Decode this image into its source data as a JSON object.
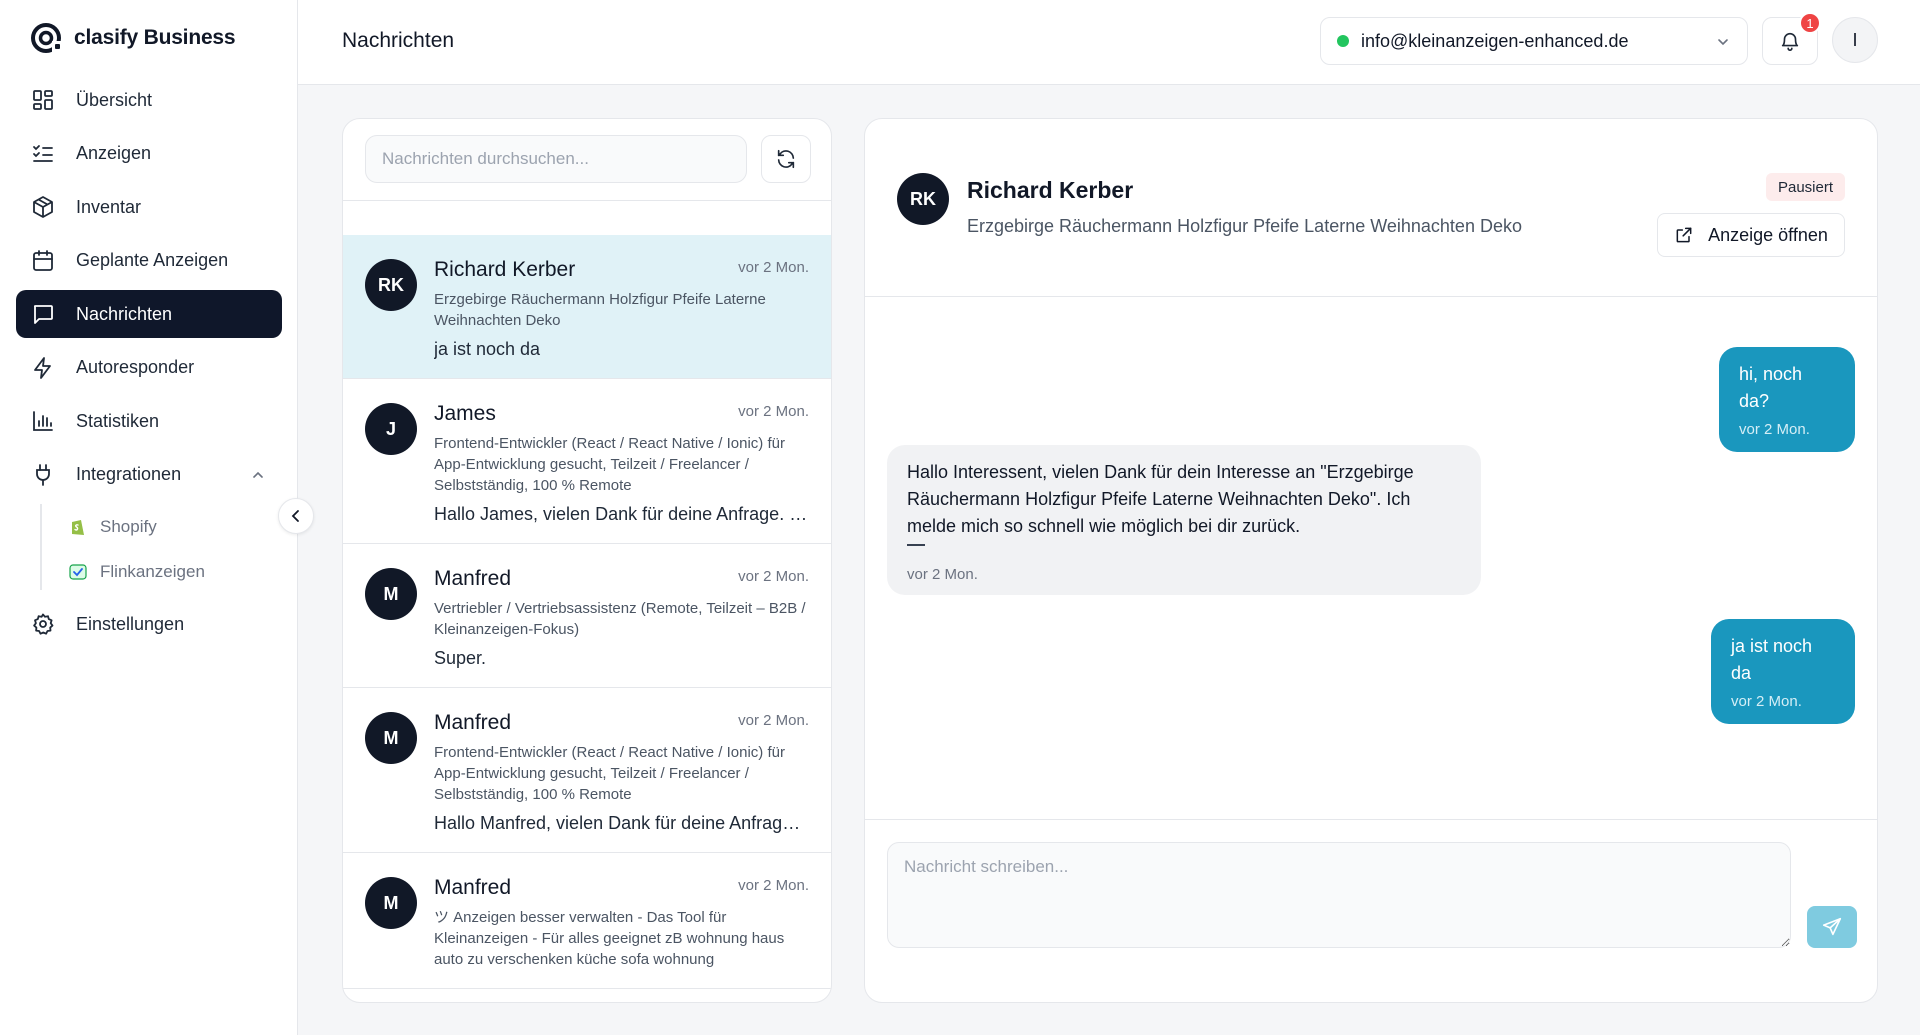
{
  "brand": {
    "name": "clasify Business"
  },
  "sidebar": {
    "items": [
      {
        "label": "Übersicht",
        "icon": "grid-icon"
      },
      {
        "label": "Anzeigen",
        "icon": "list-check-icon"
      },
      {
        "label": "Inventar",
        "icon": "package-icon"
      },
      {
        "label": "Geplante Anzeigen",
        "icon": "calendar-icon"
      },
      {
        "label": "Nachrichten",
        "icon": "message-icon",
        "active": true
      },
      {
        "label": "Autoresponder",
        "icon": "lightning-icon"
      },
      {
        "label": "Statistiken",
        "icon": "bar-chart-icon"
      },
      {
        "label": "Integrationen",
        "icon": "plug-icon",
        "expanded": true
      },
      {
        "label": "Einstellungen",
        "icon": "gear-icon"
      }
    ],
    "sub_items": [
      {
        "label": "Shopify",
        "icon": "shopify-icon"
      },
      {
        "label": "Flinkanzeigen",
        "icon": "flinkanzeigen-icon"
      }
    ]
  },
  "header": {
    "title": "Nachrichten",
    "account_email": "info@kleinanzeigen-enhanced.de",
    "notification_count": "1",
    "user_initial": "I"
  },
  "list": {
    "search_placeholder": "Nachrichten durchsuchen...",
    "conversations": [
      {
        "initials": "RK",
        "name": "Richard Kerber",
        "time": "vor 2 Mon.",
        "subject": "Erzgebirge Räuchermann Holzfigur Pfeife Laterne Weihnachten Deko",
        "preview": "ja ist noch da",
        "active": true
      },
      {
        "initials": "J",
        "name": "James",
        "time": "vor 2 Mon.",
        "subject": "Frontend-Entwickler (React / React Native / Ionic) für App-Entwicklung gesucht, Teilzeit / Freelancer / Selbstständig, 100 % Remote",
        "preview": "Hallo James, vielen Dank für deine Anfrage. Ic..."
      },
      {
        "initials": "M",
        "name": "Manfred",
        "time": "vor 2 Mon.",
        "subject": "Vertriebler / Vertriebsassistenz (Remote, Teilzeit – B2B / Kleinanzeigen-Fokus)",
        "preview": "Super."
      },
      {
        "initials": "M",
        "name": "Manfred",
        "time": "vor 2 Mon.",
        "subject": "Frontend-Entwickler (React / React Native / Ionic) für App-Entwicklung gesucht, Teilzeit / Freelancer / Selbstständig, 100 % Remote",
        "preview": "Hallo Manfred, vielen Dank für deine Anfrage. I..."
      },
      {
        "initials": "M",
        "name": "Manfred",
        "time": "vor 2 Mon.",
        "subject": "ツ Anzeigen besser verwalten - Das Tool für Kleinanzeigen - Für alles geeignet zB wohnung haus auto zu verschenken küche sofa wohnung",
        "preview": ""
      }
    ]
  },
  "chat": {
    "initials": "RK",
    "name": "Richard Kerber",
    "subject": "Erzgebirge Räuchermann Holzfigur Pfeife Laterne Weihnachten Deko",
    "status": "Pausiert",
    "open_ad_label": "Anzeige öffnen",
    "messages": [
      {
        "direction": "out",
        "text": "hi, noch da?",
        "time": "vor 2 Mon."
      },
      {
        "direction": "in",
        "text": "Hallo Interessent, vielen Dank für dein Interesse an \"Erzgebirge Räuchermann Holzfigur Pfeife Laterne Weihnachten Deko\". Ich melde mich so schnell wie möglich bei dir zurück.",
        "time": "vor 2 Mon."
      },
      {
        "direction": "out",
        "text": "ja ist noch da",
        "time": "vor 2 Mon."
      }
    ],
    "composer_placeholder": "Nachricht schreiben..."
  },
  "colors": {
    "sidebar_active": "#0f172a",
    "outgoing_bubble": "#1a97be",
    "active_conversation": "#e0f2f7",
    "status_online": "#22c55e",
    "notification_badge": "#ef4444",
    "send_button": "#7fcbe0"
  }
}
